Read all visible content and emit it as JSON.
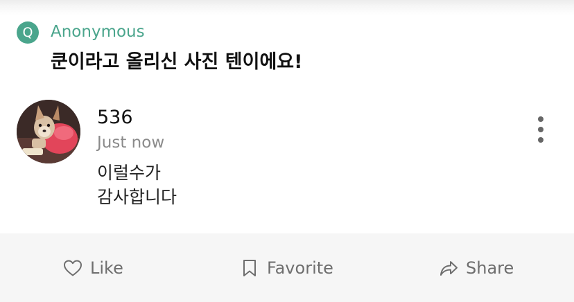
{
  "question": {
    "badge": "Q",
    "asker": "Anonymous",
    "text": "쿤이라고 올리신 사진 텐이에요!"
  },
  "answer": {
    "author": "536",
    "timestamp": "Just now",
    "lines": [
      "이럴수가",
      "감사합니다"
    ]
  },
  "actions": {
    "like_label": "Like",
    "favorite_label": "Favorite",
    "share_label": "Share"
  },
  "icons": {
    "like": "heart-icon",
    "favorite": "bookmark-icon",
    "share": "share-arrow-icon",
    "more": "more-vertical-icon"
  },
  "colors": {
    "accent": "#4aa58c",
    "text": "#111111",
    "muted": "#8a8a8a",
    "action_bar": "#f6f6f6"
  }
}
